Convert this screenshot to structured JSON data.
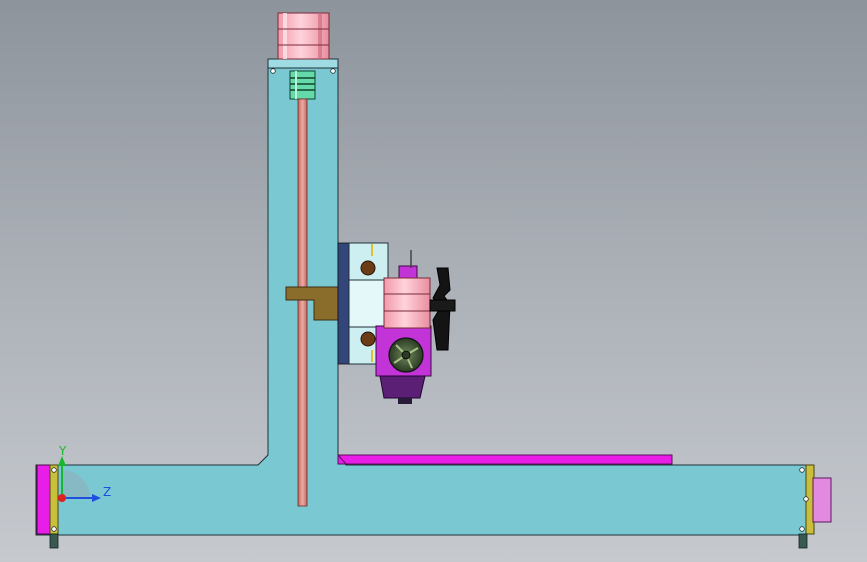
{
  "colors": {
    "background_top": "#8e949c",
    "background_bottom": "#c6cacf",
    "frame": "#79c8d2",
    "motor": "#f5a9b5",
    "coupler": "#66d9a8",
    "leadscrew": "#e8938f",
    "bracket": "#8a6d2b",
    "block": "#cdeff2",
    "extruder": "#c234d8",
    "rail": "#e81ee8",
    "fan": "#141414",
    "nut": "#6b3c16",
    "outline": "#1f3036",
    "axis_y": "#18b82e",
    "axis_z": "#1f4fe0",
    "axis_origin": "#e02020"
  },
  "triad": {
    "y_label": "Y",
    "z_label": "Z"
  }
}
